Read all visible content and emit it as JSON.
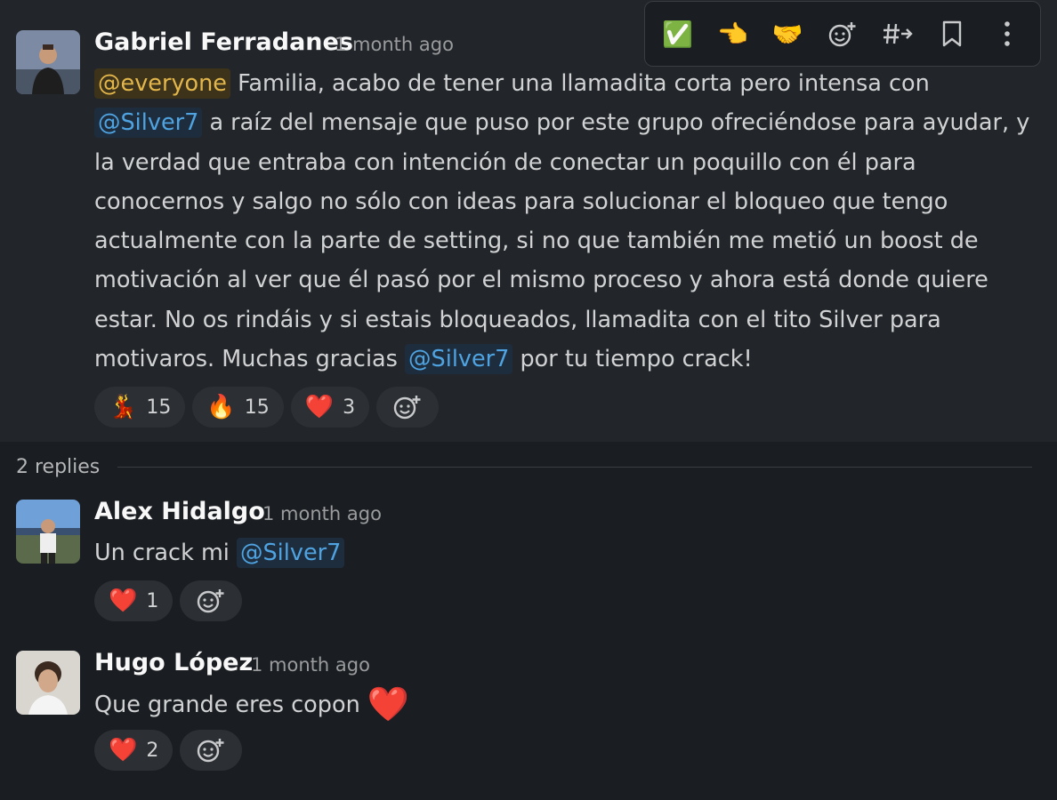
{
  "toolbar": {
    "items": [
      {
        "name": "completed-reaction",
        "glyph": "✅"
      },
      {
        "name": "point-reaction",
        "glyph": "🫲"
      },
      {
        "name": "handshake-reaction",
        "glyph": "🤝"
      },
      {
        "name": "add-reaction",
        "glyph": "☺+"
      },
      {
        "name": "share-to-channel",
        "glyph": "#→"
      },
      {
        "name": "save-for-later",
        "glyph": "🔖"
      },
      {
        "name": "more-actions",
        "glyph": "⋮"
      }
    ]
  },
  "parent": {
    "author": "Gabriel Ferradanes",
    "time": "1 month ago",
    "mention_everyone": "@everyone",
    "text_1": " Familia, acabo de tener una llamadita corta pero intensa con ",
    "mention_1": "@Silver7",
    "text_2": " a raíz del mensaje que puso por este grupo ofreciéndose para ayudar, y la verdad que entraba con intención de conectar un poquillo con él para conocernos y salgo no sólo con ideas para solucionar el bloqueo que tengo actualmente con la parte de setting, si no que también me metió un boost de motivación al ver que él pasó por el mismo proceso y ahora está donde quiere estar. No os rindáis y si estais bloqueados, llamadita con el tito Silver para motivaros. Muchas gracias ",
    "mention_2": "@Silver7",
    "text_3": " por tu tiempo crack!",
    "reactions": [
      {
        "emoji": "💃",
        "count": "15"
      },
      {
        "emoji": "🔥",
        "count": "15"
      },
      {
        "emoji": "❤️",
        "count": "3"
      }
    ]
  },
  "replies_label": "2 replies",
  "reply_1": {
    "author": "Alex Hidalgo",
    "time": "1 month ago",
    "text": "Un crack mi ",
    "mention": "@Silver7",
    "reactions": [
      {
        "emoji": "❤️",
        "count": "1"
      }
    ]
  },
  "reply_2": {
    "author": "Hugo López",
    "time": "1 month ago",
    "text": "Que grande eres copon ",
    "emoji": "❤️",
    "reactions": [
      {
        "emoji": "❤️",
        "count": "2"
      }
    ]
  },
  "colors": {
    "background": "#1a1d21",
    "hover_background": "#222529",
    "mention": "#4fa3e0",
    "everyone_mention": "#e2b64a"
  }
}
